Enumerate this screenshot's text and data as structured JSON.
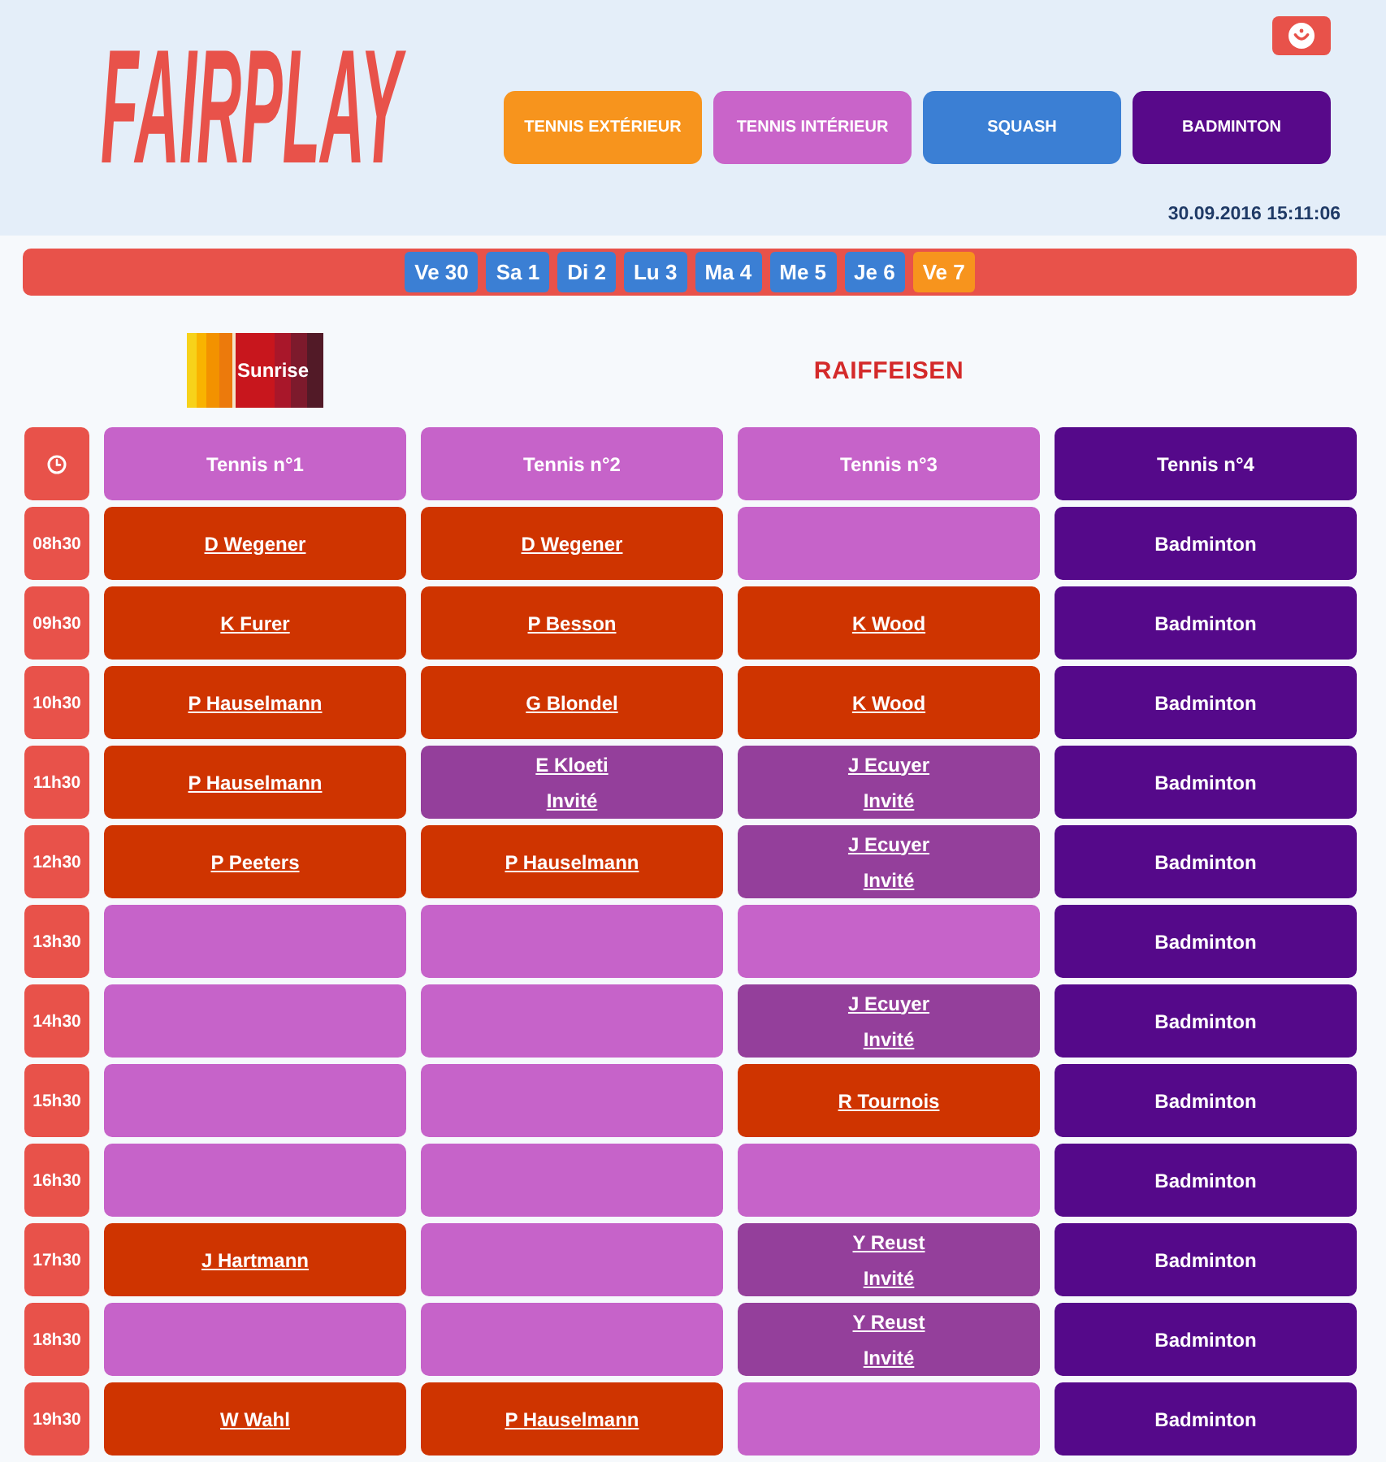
{
  "header": {
    "logo": "FAIRPLAY",
    "sports": [
      {
        "label": "TENNIS EXTÉRIEUR",
        "color": "#f7941d"
      },
      {
        "label": "TENNIS INTÉRIEUR",
        "color": "#c964c9"
      },
      {
        "label": "SQUASH",
        "color": "#3b7fd4"
      },
      {
        "label": "BADMINTON",
        "color": "#58098a"
      }
    ],
    "datetime": "30.09.2016 15:11:06"
  },
  "days": [
    {
      "label": "Ve 30",
      "selected": false
    },
    {
      "label": "Sa 1",
      "selected": false
    },
    {
      "label": "Di 2",
      "selected": false
    },
    {
      "label": "Lu 3",
      "selected": false
    },
    {
      "label": "Ma 4",
      "selected": false
    },
    {
      "label": "Me 5",
      "selected": false
    },
    {
      "label": "Je 6",
      "selected": false
    },
    {
      "label": "Ve 7",
      "selected": true
    }
  ],
  "sponsors": [
    {
      "kind": "tile",
      "label": "Sunrise"
    },
    {
      "kind": "wordmark",
      "label": "RAIFFEISEN"
    }
  ],
  "schedule": {
    "columns": [
      {
        "label": "Tennis n°1",
        "color": "#c663c9"
      },
      {
        "label": "Tennis n°2",
        "color": "#c663c9"
      },
      {
        "label": "Tennis n°3",
        "color": "#c663c9"
      },
      {
        "label": "Tennis n°4",
        "color": "#55098a"
      }
    ],
    "rows": [
      {
        "time": "08h30",
        "slots": [
          {
            "kind": "booked",
            "name": "D Wegener"
          },
          {
            "kind": "booked",
            "name": "D Wegener"
          },
          {
            "kind": "free"
          },
          {
            "kind": "blocked",
            "label": "Badminton"
          }
        ]
      },
      {
        "time": "09h30",
        "slots": [
          {
            "kind": "booked",
            "name": "K Furer"
          },
          {
            "kind": "booked",
            "name": "P Besson"
          },
          {
            "kind": "booked",
            "name": "K Wood"
          },
          {
            "kind": "blocked",
            "label": "Badminton"
          }
        ]
      },
      {
        "time": "10h30",
        "slots": [
          {
            "kind": "booked",
            "name": "P Hauselmann"
          },
          {
            "kind": "booked",
            "name": "G Blondel"
          },
          {
            "kind": "booked",
            "name": "K Wood"
          },
          {
            "kind": "blocked",
            "label": "Badminton"
          }
        ]
      },
      {
        "time": "11h30",
        "slots": [
          {
            "kind": "booked",
            "name": "P Hauselmann"
          },
          {
            "kind": "guest",
            "name": "E Kloeti",
            "note": "Invité"
          },
          {
            "kind": "guest",
            "name": "J Ecuyer",
            "note": "Invité"
          },
          {
            "kind": "blocked",
            "label": "Badminton"
          }
        ]
      },
      {
        "time": "12h30",
        "slots": [
          {
            "kind": "booked",
            "name": "P Peeters"
          },
          {
            "kind": "booked",
            "name": "P Hauselmann"
          },
          {
            "kind": "guest",
            "name": "J Ecuyer",
            "note": "Invité"
          },
          {
            "kind": "blocked",
            "label": "Badminton"
          }
        ]
      },
      {
        "time": "13h30",
        "slots": [
          {
            "kind": "free"
          },
          {
            "kind": "free"
          },
          {
            "kind": "free"
          },
          {
            "kind": "blocked",
            "label": "Badminton"
          }
        ]
      },
      {
        "time": "14h30",
        "slots": [
          {
            "kind": "free"
          },
          {
            "kind": "free"
          },
          {
            "kind": "guest",
            "name": "J Ecuyer",
            "note": "Invité"
          },
          {
            "kind": "blocked",
            "label": "Badminton"
          }
        ]
      },
      {
        "time": "15h30",
        "slots": [
          {
            "kind": "free"
          },
          {
            "kind": "free"
          },
          {
            "kind": "booked",
            "name": "R Tournois"
          },
          {
            "kind": "blocked",
            "label": "Badminton"
          }
        ]
      },
      {
        "time": "16h30",
        "slots": [
          {
            "kind": "free"
          },
          {
            "kind": "free"
          },
          {
            "kind": "free"
          },
          {
            "kind": "blocked",
            "label": "Badminton"
          }
        ]
      },
      {
        "time": "17h30",
        "slots": [
          {
            "kind": "booked",
            "name": "J Hartmann"
          },
          {
            "kind": "free"
          },
          {
            "kind": "guest",
            "name": "Y Reust",
            "note": "Invité"
          },
          {
            "kind": "blocked",
            "label": "Badminton"
          }
        ]
      },
      {
        "time": "18h30",
        "slots": [
          {
            "kind": "free"
          },
          {
            "kind": "free"
          },
          {
            "kind": "guest",
            "name": "Y Reust",
            "note": "Invité"
          },
          {
            "kind": "blocked",
            "label": "Badminton"
          }
        ]
      },
      {
        "time": "19h30",
        "slots": [
          {
            "kind": "booked",
            "name": "W Wahl"
          },
          {
            "kind": "booked",
            "name": "P Hauselmann"
          },
          {
            "kind": "free"
          },
          {
            "kind": "blocked",
            "label": "Badminton"
          }
        ]
      }
    ]
  }
}
